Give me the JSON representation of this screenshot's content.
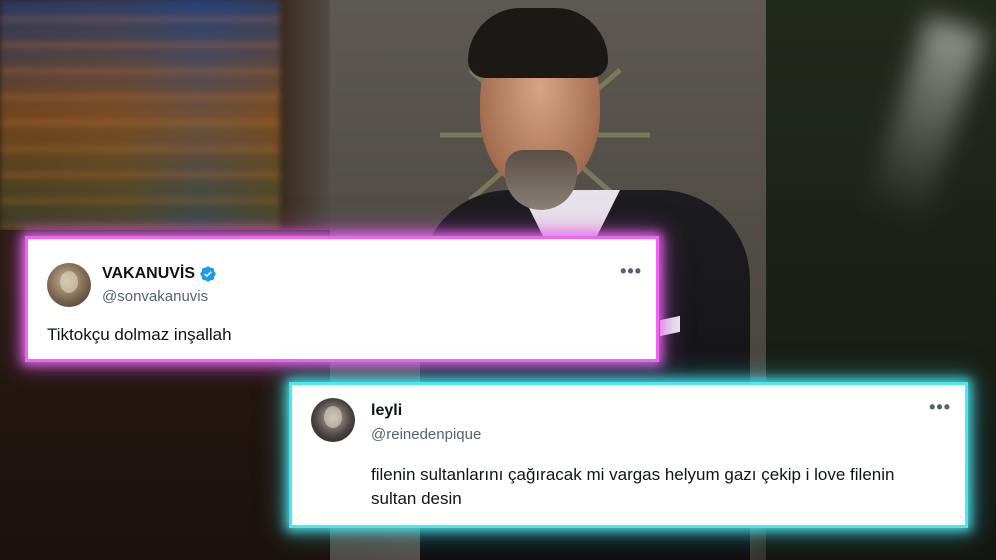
{
  "tweets": [
    {
      "display_name": "VAKANUVİS",
      "verified": true,
      "handle": "@sonvakanuvis",
      "text": "Tiktokçu dolmaz inşallah",
      "more_icon": "more-horizontal-icon",
      "border_color": "#f163f5"
    },
    {
      "display_name": "leyli",
      "verified": false,
      "handle": "@reinedenpique",
      "text": "filenin sultanlarını çağıracak mi vargas helyum gazı çekip i love filenin sultan desin",
      "more_icon": "more-horizontal-icon",
      "border_color": "#49e8f0"
    }
  ],
  "icons": {
    "verified": "verified-badge-icon",
    "more": "•••"
  },
  "colors": {
    "verified_blue": "#1d9bf0",
    "text": "#0f1419",
    "secondary_text": "#536471"
  }
}
